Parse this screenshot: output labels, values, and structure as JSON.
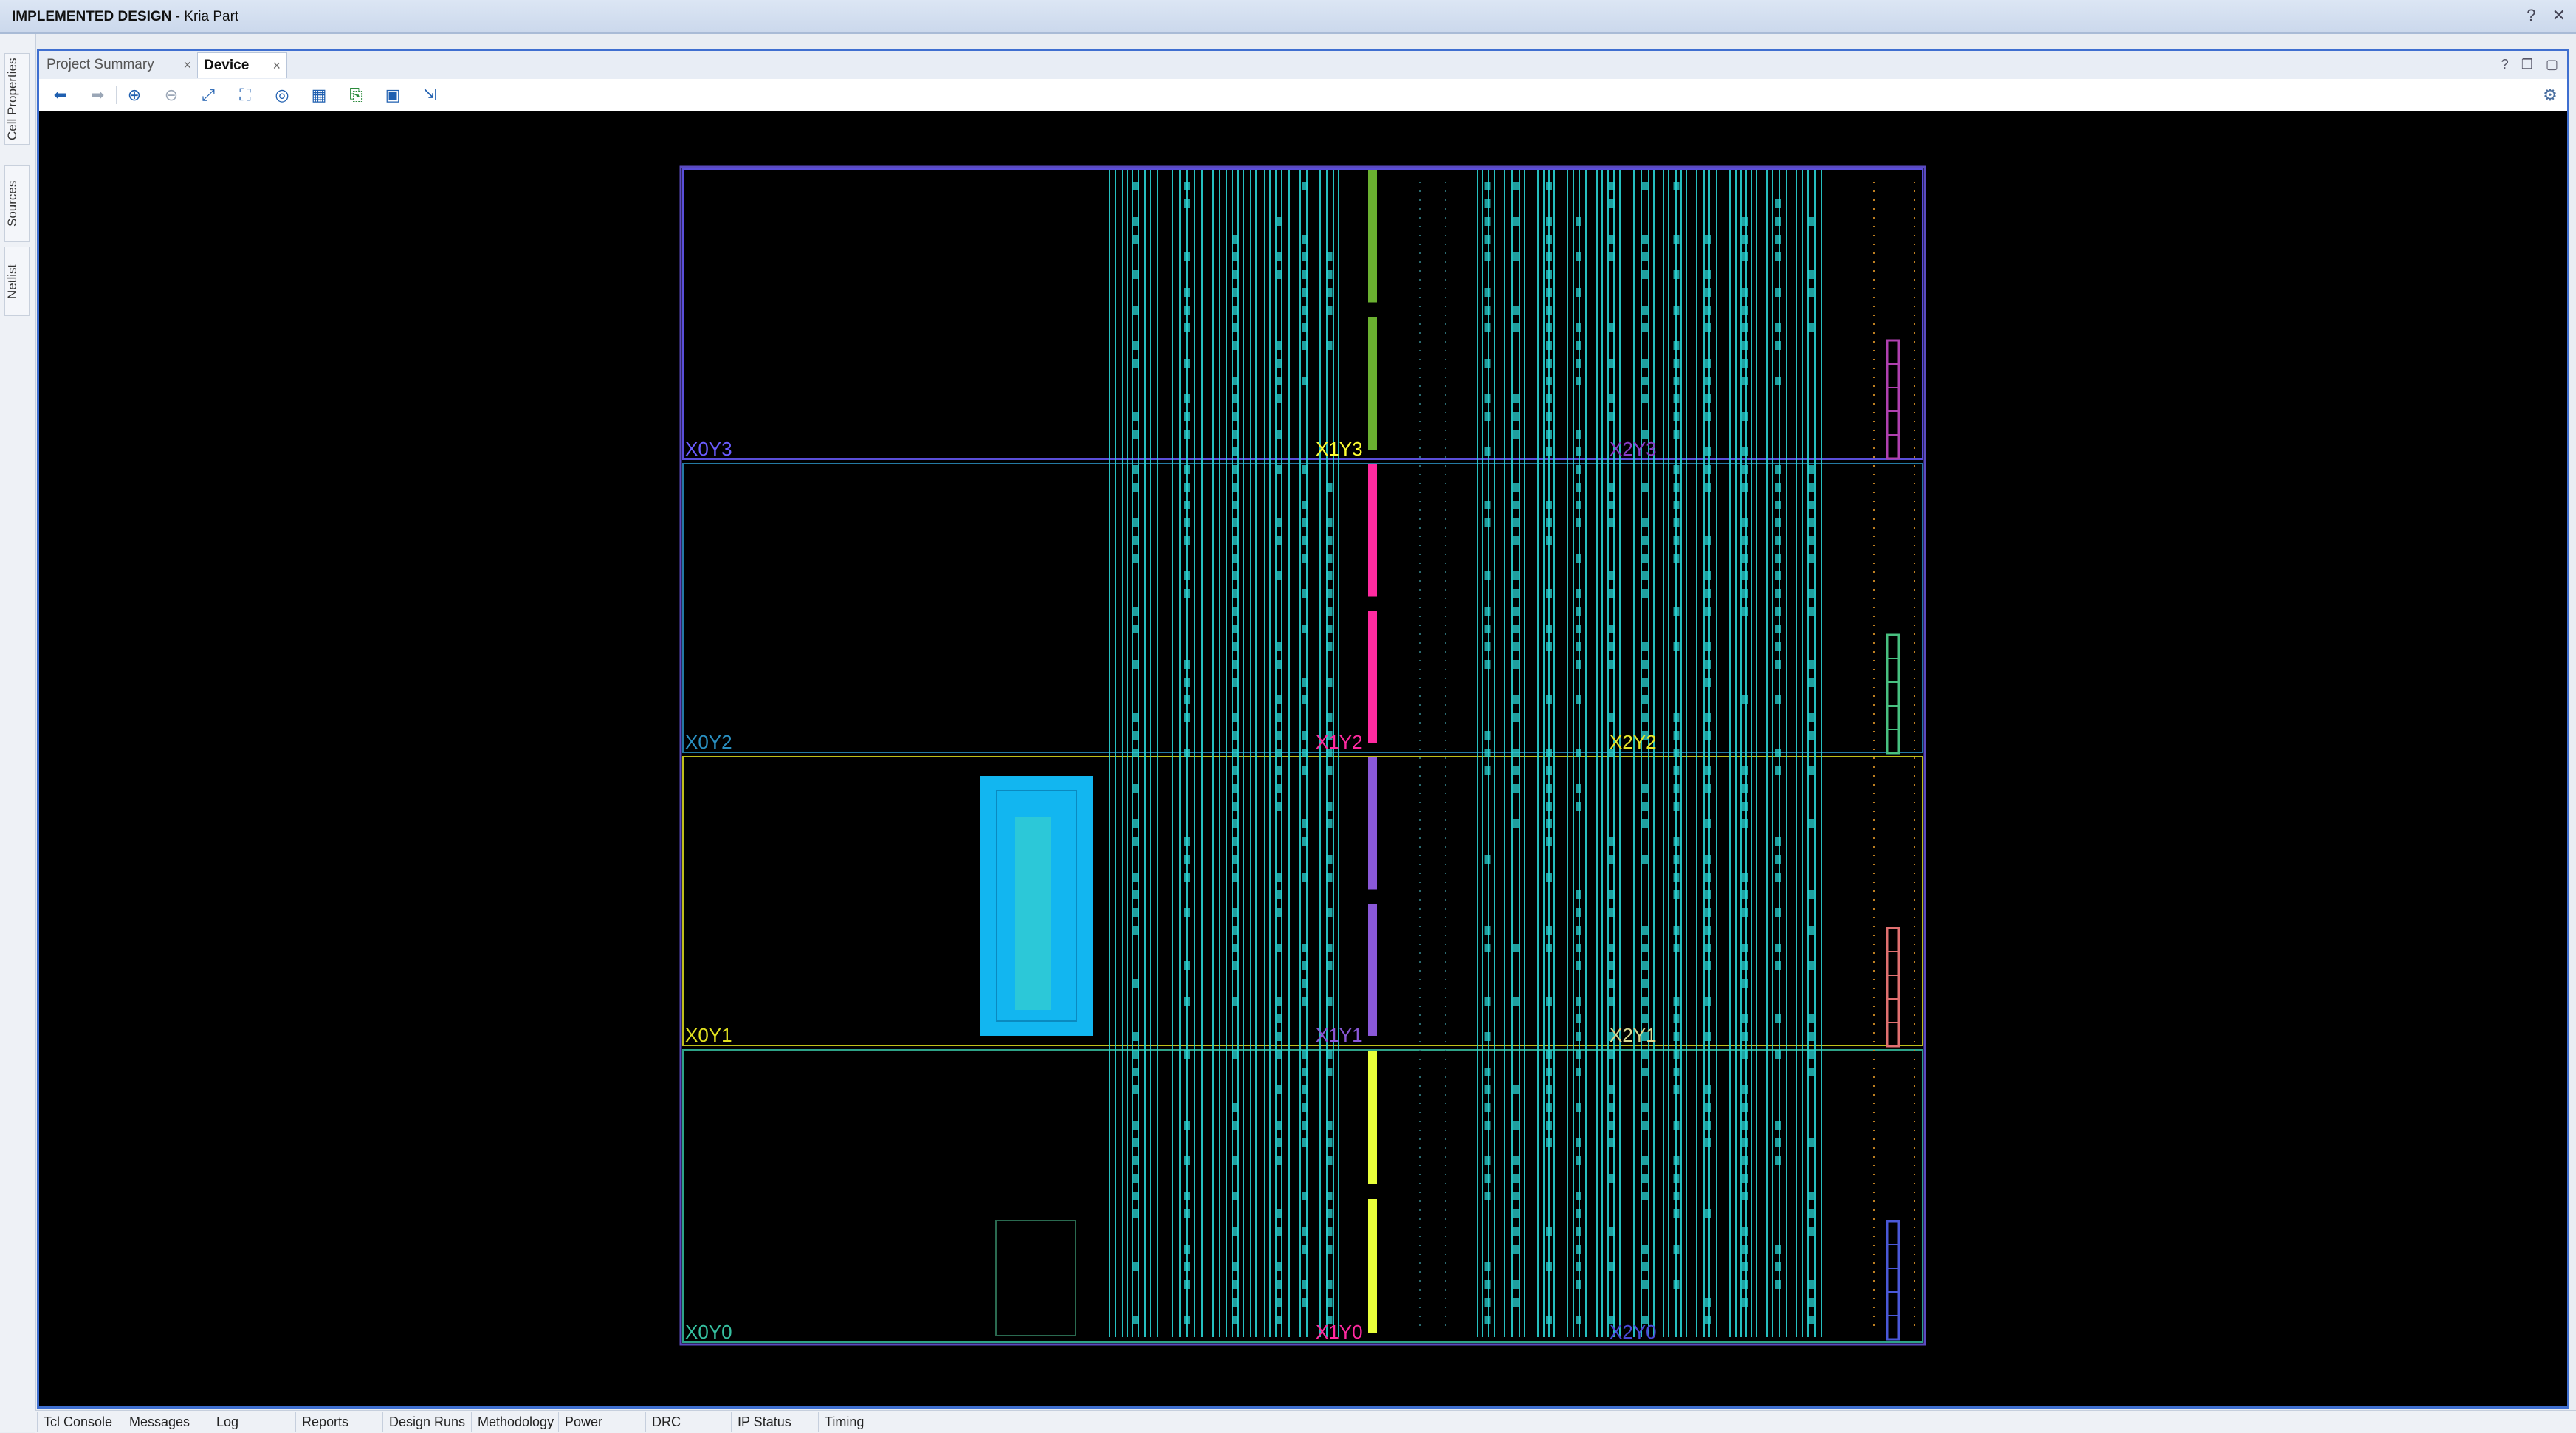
{
  "titlebar": {
    "prefix": "IMPLEMENTED DESIGN",
    "suffix": " - Kria Part",
    "icons": [
      "help-icon",
      "close-icon"
    ]
  },
  "side_tabs": [
    "Cell Properties",
    "Sources",
    "Netlist"
  ],
  "doc_tabs": [
    {
      "label": "Project Summary",
      "active": false
    },
    {
      "label": "Device",
      "active": true
    }
  ],
  "toolbar": {
    "buttons": [
      "back",
      "forward",
      "zoom-in",
      "zoom-out",
      "zoom-fit",
      "zoom-selected",
      "autofit",
      "routing-resources",
      "show-io",
      "select-area",
      "show-nets"
    ],
    "settings": "settings"
  },
  "device": {
    "clock_regions": [
      {
        "label": "X0Y3",
        "color": "#6a5cff"
      },
      {
        "label": "X1Y3",
        "color": "#ffff33"
      },
      {
        "label": "X2Y3",
        "color": "#8a3cc8"
      },
      {
        "label": "X0Y2",
        "color": "#2a8fc0"
      },
      {
        "label": "X1Y2",
        "color": "#ff2aa0"
      },
      {
        "label": "X2Y2",
        "color": "#e6e62a"
      },
      {
        "label": "X0Y1",
        "color": "#e0e020"
      },
      {
        "label": "X1Y1",
        "color": "#8a58d8"
      },
      {
        "label": "X2Y1",
        "color": "#d8d890"
      },
      {
        "label": "X0Y0",
        "color": "#36c0a0"
      },
      {
        "label": "X1Y0",
        "color": "#ff2aa0"
      },
      {
        "label": "X2Y0",
        "color": "#4a4ad8"
      }
    ],
    "colors": {
      "fabric": "#2ad4d4",
      "pblock": "#12b6f0",
      "pblock_inner": "#2cc8d8"
    }
  },
  "bottom_tabs": [
    "Tcl Console",
    "Messages",
    "Log",
    "Reports",
    "Design Runs",
    "Methodology",
    "Power",
    "DRC",
    "IP Status",
    "Timing"
  ]
}
